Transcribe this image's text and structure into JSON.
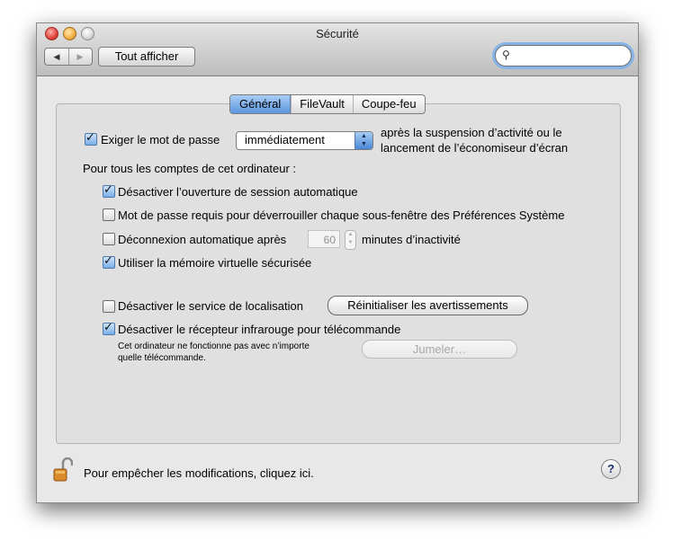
{
  "window": {
    "title": "Sécurité"
  },
  "toolbar": {
    "back_label": "◀",
    "forward_label": "▶",
    "show_all_label": "Tout afficher",
    "search_icon": "⚲",
    "search_value": ""
  },
  "tabs": [
    {
      "label": "Général",
      "selected": true
    },
    {
      "label": "FileVault",
      "selected": false
    },
    {
      "label": "Coupe-feu",
      "selected": false
    }
  ],
  "general": {
    "require_password": {
      "label": "Exiger le mot de passe",
      "checked": true
    },
    "delay_popup": {
      "value": "immédiatement"
    },
    "after_text_line1": "après la suspension d’activité ou le",
    "after_text_line2": "lancement de l’économiseur d’écran",
    "all_accounts_label": "Pour tous les comptes de cet ordinateur :",
    "disable_auto_login": {
      "label": "Désactiver l’ouverture de session automatique",
      "checked": true
    },
    "require_password_panes": {
      "label": "Mot de passe requis pour déverrouiller chaque sous-fenêtre des Préférences Système",
      "checked": false
    },
    "auto_logout": {
      "label": "Déconnexion automatique après",
      "checked": false
    },
    "auto_logout_minutes": "60",
    "auto_logout_suffix": "minutes d’inactivité",
    "secure_vm": {
      "label": "Utiliser la mémoire virtuelle sécurisée",
      "checked": true
    },
    "disable_location": {
      "label": "Désactiver le service de localisation",
      "checked": false
    },
    "reset_warnings_label": "Réinitialiser les avertissements",
    "disable_ir": {
      "label": "Désactiver le récepteur infrarouge pour télécommande",
      "checked": true
    },
    "ir_note_line1": "Cet ordinateur ne fonctionne pas avec n’importe",
    "ir_note_line2": "quelle télécommande.",
    "pair_label": "Jumeler…"
  },
  "footer": {
    "lock_text": "Pour empêcher les modifications, cliquez ici.",
    "help_label": "?"
  },
  "colors": {
    "accent": "#5c97e0",
    "window_bg": "#e8e8e8"
  }
}
